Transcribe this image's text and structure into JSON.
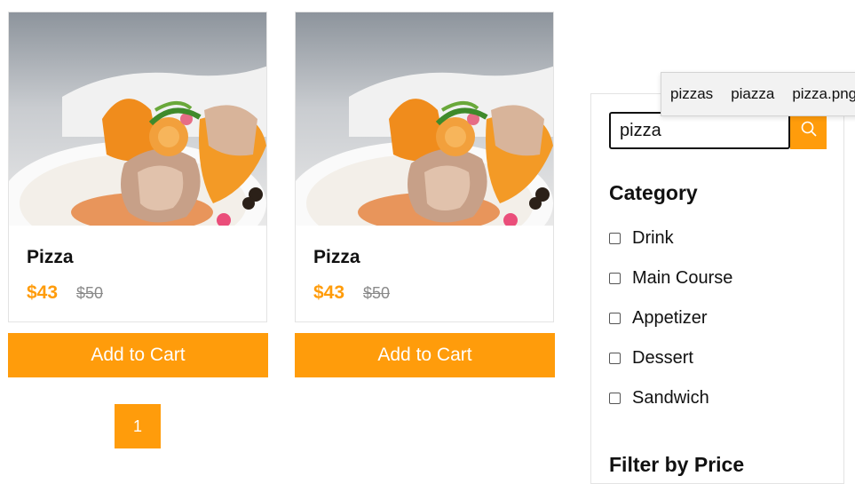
{
  "products": [
    {
      "name": "Pizza",
      "price": "$43",
      "old_price": "$50",
      "cta": "Add to Cart"
    },
    {
      "name": "Pizza",
      "price": "$43",
      "old_price": "$50",
      "cta": "Add to Cart"
    }
  ],
  "pagination": {
    "current": "1"
  },
  "search": {
    "value": "pizza",
    "icon": "search-icon"
  },
  "suggestions": [
    "pizzas",
    "piazza",
    "pizza.png"
  ],
  "category": {
    "title": "Category",
    "items": [
      "Drink",
      "Main Course",
      "Appetizer",
      "Dessert",
      "Sandwich"
    ]
  },
  "filter": {
    "title": "Filter by Price"
  },
  "colors": {
    "accent": "#ff9c0b",
    "old_price": "#8a8a8a"
  }
}
